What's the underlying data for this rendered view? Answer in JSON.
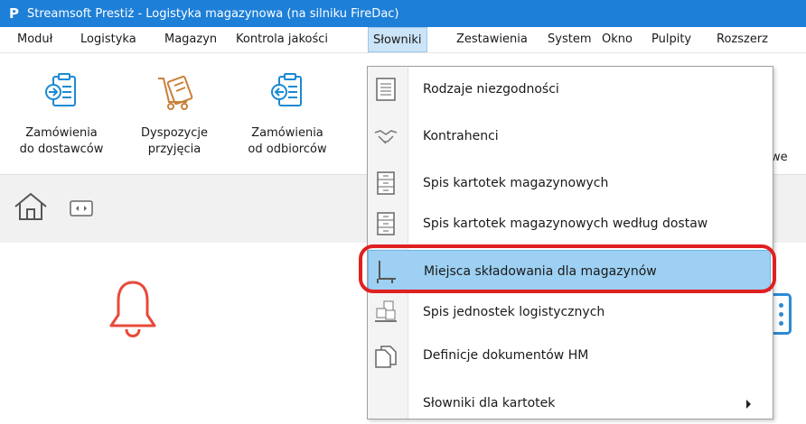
{
  "window": {
    "title": "Streamsoft Prestiż - Logistyka magazynowa (na silniku FireDac)",
    "logo": "P"
  },
  "menu": [
    {
      "label": "Moduł"
    },
    {
      "label": "Logistyka"
    },
    {
      "label": "Magazyn"
    },
    {
      "label": "Kontrola jakości"
    },
    {
      "label": "Słowniki",
      "active": true
    },
    {
      "label": "Zestawienia"
    },
    {
      "label": "System"
    },
    {
      "label": "Okno"
    },
    {
      "label": "Pulpity"
    },
    {
      "label": "Rozszerz"
    }
  ],
  "ribbon": {
    "buttons": [
      {
        "line1": "Zamówienia",
        "line2": "do dostawców",
        "icon": "clipboard-in-icon"
      },
      {
        "line1": "Dyspozycje",
        "line2": "przyjęcia",
        "icon": "cart-clipboard-icon"
      },
      {
        "line1": "Zamówienia",
        "line2": "od odbiorców",
        "icon": "clipboard-out-icon"
      }
    ],
    "partial_label": "we"
  },
  "dropdown": {
    "items": [
      {
        "label": "Rodzaje niezgodności",
        "icon": "list-document-icon"
      },
      {
        "label": "Kontrahenci",
        "icon": "handshake-icon"
      },
      {
        "label": "Spis kartotek magazynowych",
        "icon": "cabinet-icon"
      },
      {
        "label": "Spis kartotek magazynowych według dostaw",
        "icon": "cabinet-icon"
      },
      {
        "label": "Miejsca składowania dla magazynów",
        "icon": "storage-rack-icon",
        "highlighted": true
      },
      {
        "label": "Spis jednostek logistycznych",
        "icon": "pallet-boxes-icon"
      },
      {
        "label": "Definicje dokumentów HM",
        "icon": "documents-icon"
      },
      {
        "label": "Słowniki dla kartotek",
        "icon": "",
        "submenu": true
      }
    ]
  },
  "colors": {
    "titlebar": "#1d7fd8",
    "menu_active": "#cce4f7",
    "item_highlight": "#9dd0f2",
    "annotation_ring": "#e02020",
    "bell": "#e84a3a"
  }
}
